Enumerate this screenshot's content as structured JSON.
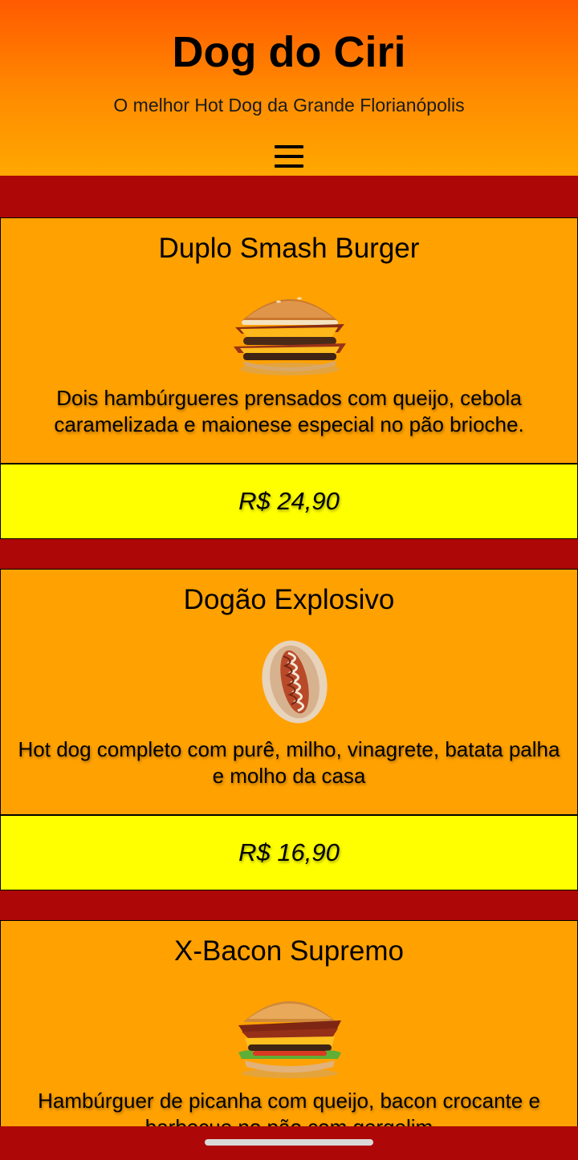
{
  "header": {
    "title": "Dog do Ciri",
    "subtitle": "O melhor Hot Dog da Grande Florianópolis",
    "menu_icon": "hamburger-menu-icon"
  },
  "products": [
    {
      "name": "Duplo Smash Burger",
      "description": "Dois hambúrgueres prensados com queijo, cebola caramelizada e maionese especial no pão brioche.",
      "price": "R$ 24,90"
    },
    {
      "name": "Dogão Explosivo",
      "description": "Hot dog completo com purê, milho, vinagrete, batata palha e molho da casa",
      "price": "R$ 16,90"
    },
    {
      "name": "X-Bacon Supremo",
      "description": "Hambúrguer de picanha com queijo, bacon crocante e barbecue no pão com gergelim"
    }
  ],
  "colors": {
    "header_top": "#ff5a00",
    "header_bottom": "#ffa800",
    "background": "#ad0707",
    "card": "#ffa100",
    "price_band": "#ffff00"
  }
}
